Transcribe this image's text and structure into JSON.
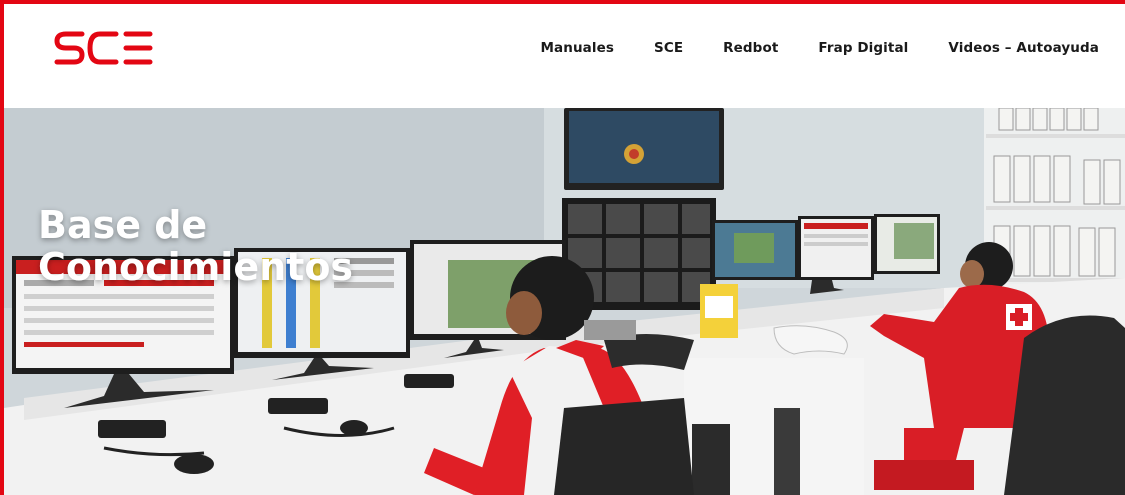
{
  "brand": {
    "logo_text": "SCE",
    "color": "#e30613"
  },
  "nav": {
    "items": [
      {
        "label": "Manuales"
      },
      {
        "label": "SCE"
      },
      {
        "label": "Redbot"
      },
      {
        "label": "Frap Digital"
      },
      {
        "label": "Videos – Autoayuda"
      }
    ]
  },
  "hero": {
    "title_line1": "Base de",
    "title_line2": "Conocimientos",
    "photo_subject": "control-room-photo"
  }
}
